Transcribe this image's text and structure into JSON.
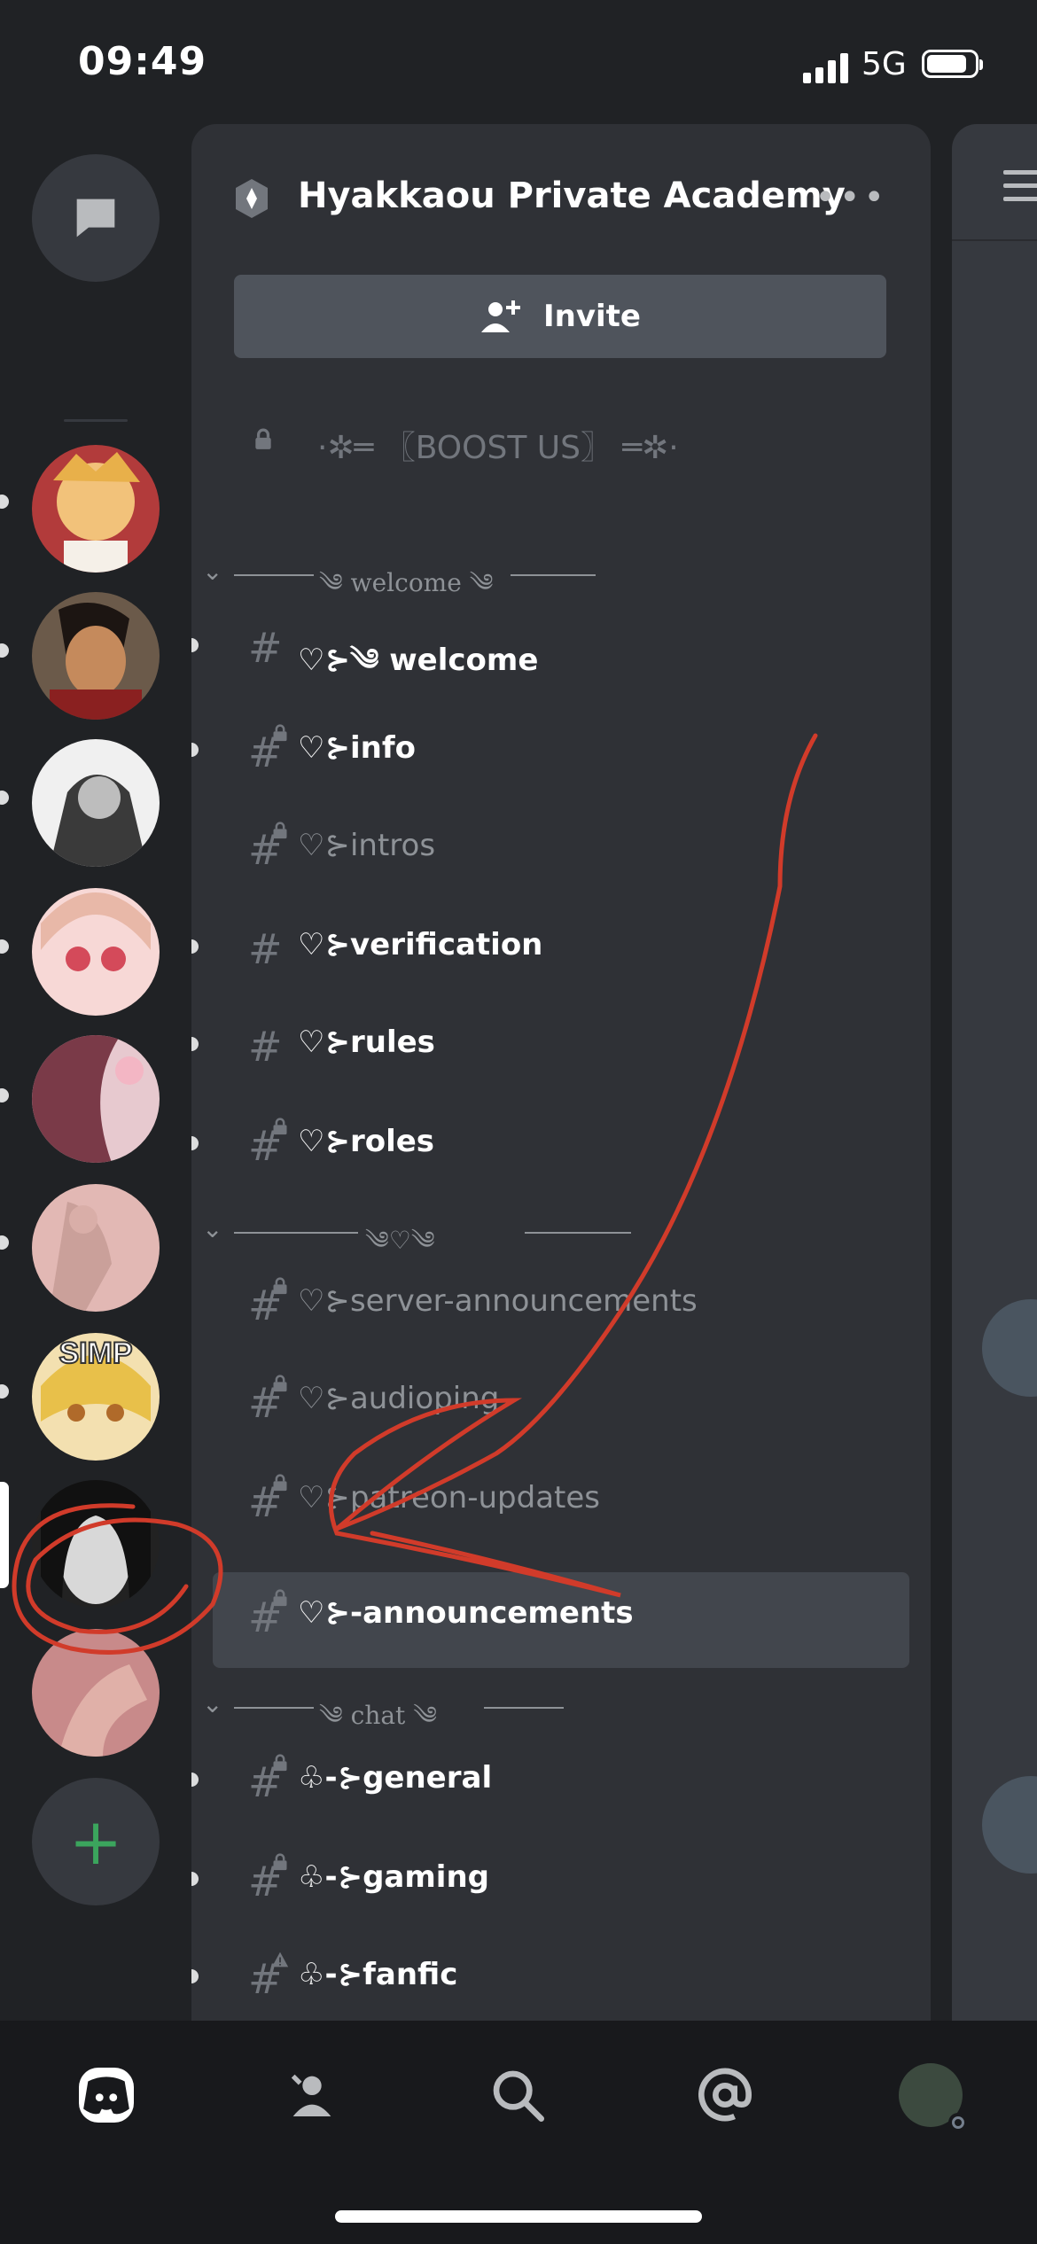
{
  "status_bar": {
    "time": "09:49",
    "network": "5G"
  },
  "server": {
    "name": "Hyakkaou Private Academy",
    "more_label": "•••",
    "invite_label": "Invite"
  },
  "rail": {
    "servers": [
      {
        "name": "server-1",
        "color": "#c99b54",
        "accent": "#f2d27a"
      },
      {
        "name": "server-2",
        "color": "#5a2a22",
        "accent": "#b8382e"
      },
      {
        "name": "server-3",
        "color": "#d8d8d8",
        "accent": "#555555"
      },
      {
        "name": "server-4",
        "color": "#f3c6c6",
        "accent": "#d47b86"
      },
      {
        "name": "server-5",
        "color": "#9c6a78",
        "accent": "#e7b7c0"
      },
      {
        "name": "server-6",
        "color": "#d8a8a4",
        "accent": "#b27c78"
      },
      {
        "name": "server-7",
        "color": "#e8c66a",
        "accent": "#4a3d2a",
        "label": "SIMP"
      },
      {
        "name": "server-8",
        "color": "#2a2a2a",
        "accent": "#dddddd"
      },
      {
        "name": "server-9",
        "color": "#c98989",
        "accent": "#a86060"
      }
    ]
  },
  "boost": {
    "label": "·✲═ 〖BOOST US〗 ═✲·"
  },
  "categories": [
    {
      "label": "༄ welcome ༄"
    },
    {
      "label": "༄♡༄"
    },
    {
      "label": "༄ chat ༄"
    }
  ],
  "channels": [
    {
      "name": "♡⊱༄ welcome",
      "state": "unread",
      "locked": false
    },
    {
      "name": "♡⊱info",
      "state": "unread",
      "locked": true
    },
    {
      "name": "♡⊱intros",
      "state": "muted",
      "locked": true
    },
    {
      "name": "♡⊱verification",
      "state": "unread",
      "locked": false
    },
    {
      "name": "♡⊱rules",
      "state": "unread",
      "locked": false
    },
    {
      "name": "♡⊱roles",
      "state": "unread",
      "locked": true
    },
    {
      "name": "♡⊱server-announcements",
      "state": "muted",
      "locked": true
    },
    {
      "name": "♡⊱audioping",
      "state": "muted",
      "locked": true
    },
    {
      "name": "♡⊱patreon-updates",
      "state": "muted",
      "locked": true
    },
    {
      "name": "♡⊱-announcements",
      "state": "selected",
      "locked": true
    },
    {
      "name": "♧-⊱general",
      "state": "unread",
      "locked": true
    },
    {
      "name": "♧-⊱gaming",
      "state": "unread",
      "locked": true
    },
    {
      "name": "♧-⊱fanfic",
      "state": "unread",
      "locked": true
    }
  ],
  "bottom_nav": [
    "home",
    "friends",
    "search",
    "mentions",
    "profile"
  ],
  "colors": {
    "unread": "#ffffff",
    "muted": "#8e9297",
    "accent_green": "#3ba55d",
    "annotation_red": "#d13b2a"
  }
}
